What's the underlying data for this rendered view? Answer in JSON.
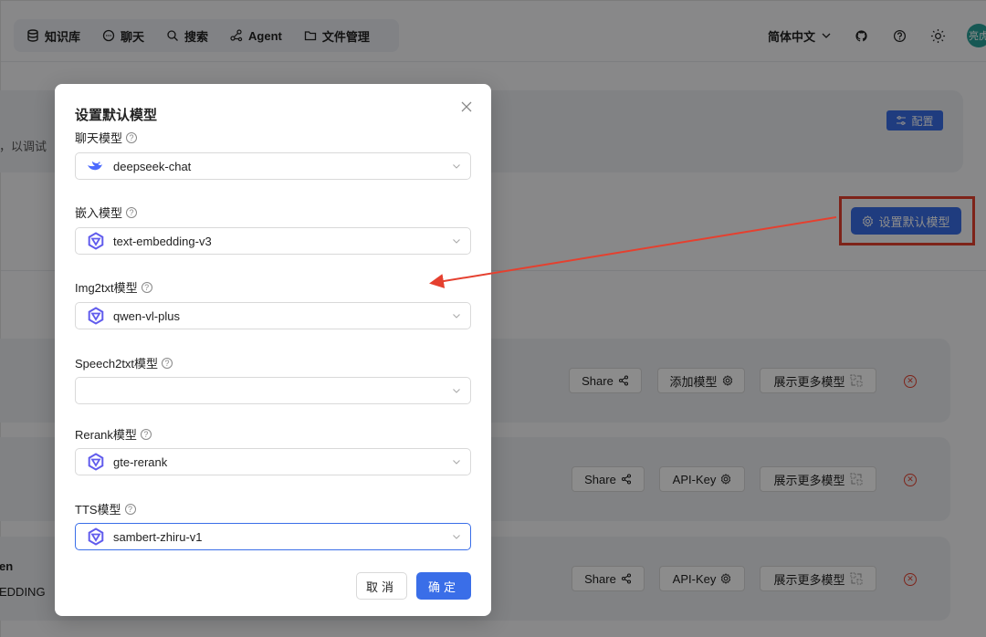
{
  "nav": {
    "items": [
      {
        "label": "知识库",
        "icon": "database-icon"
      },
      {
        "label": "聊天",
        "icon": "chat-icon"
      },
      {
        "label": "搜索",
        "icon": "search-icon"
      },
      {
        "label": "Agent",
        "icon": "agent-icon"
      },
      {
        "label": "文件管理",
        "icon": "folder-icon"
      }
    ],
    "language": "简体中文",
    "avatar_text": "亮虎"
  },
  "background": {
    "panel_text": "，以调试",
    "config_button": "配置",
    "set_default_button": "设置默认模型",
    "cards": [
      {
        "buttons": [
          "Share",
          "添加模型",
          "展示更多模型"
        ]
      },
      {
        "buttons": [
          "Share",
          "API-Key",
          "展示更多模型"
        ]
      },
      {
        "title": "en",
        "subtitle": "EDDING",
        "buttons": [
          "Share",
          "API-Key",
          "展示更多模型"
        ]
      }
    ]
  },
  "modal": {
    "title": "设置默认模型",
    "fields": [
      {
        "label": "聊天模型",
        "value": "deepseek-chat",
        "logo": "deepseek-whale-icon"
      },
      {
        "label": "嵌入模型",
        "value": "text-embedding-v3",
        "logo": "tongyi-icon"
      },
      {
        "label": "Img2txt模型",
        "value": "qwen-vl-plus",
        "logo": "tongyi-icon"
      },
      {
        "label": "Speech2txt模型",
        "value": "",
        "logo": ""
      },
      {
        "label": "Rerank模型",
        "value": "gte-rerank",
        "logo": "tongyi-icon"
      },
      {
        "label": "TTS模型",
        "value": "sambert-zhiru-v1",
        "logo": "tongyi-icon"
      }
    ],
    "cancel_label": "取消",
    "ok_label": "确定"
  },
  "colors": {
    "primary": "#3a6ee8",
    "annotation_red": "#e5402f",
    "deepseek": "#4d6bfe",
    "tongyi": "#615ced"
  }
}
